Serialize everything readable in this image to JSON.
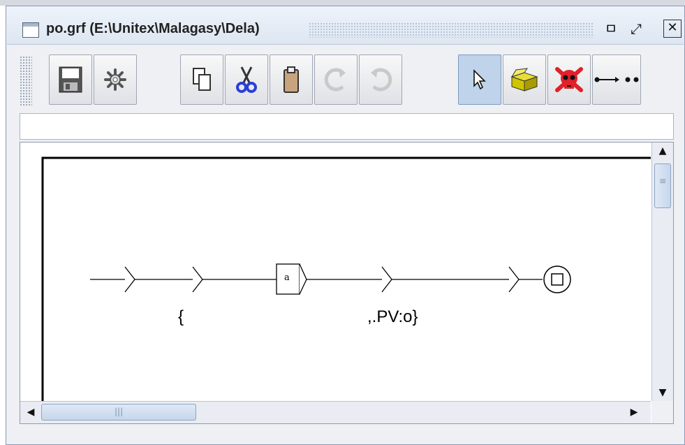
{
  "window": {
    "title": "po.grf (E:\\Unitex\\Malagasy\\Dela)",
    "icons": {
      "app": "window-icon",
      "minimize": "minimize-icon",
      "maximize": "maximize-icon",
      "close": "close-icon"
    },
    "minimize_glyph": "ㅁ",
    "maximize_glyph": "⤢",
    "close_glyph": "✕"
  },
  "toolbar": {
    "buttons": [
      {
        "id": "save",
        "icon": "save-icon"
      },
      {
        "id": "compile",
        "icon": "gear-icon"
      },
      {
        "id": "copy",
        "icon": "copy-icon"
      },
      {
        "id": "cut",
        "icon": "scissors-icon"
      },
      {
        "id": "paste",
        "icon": "paste-icon"
      },
      {
        "id": "redo",
        "icon": "redo-icon"
      },
      {
        "id": "undo",
        "icon": "undo-icon"
      },
      {
        "id": "select",
        "icon": "pointer-icon",
        "active": true
      },
      {
        "id": "open-box",
        "icon": "box-icon"
      },
      {
        "id": "kill",
        "icon": "skull-icon"
      },
      {
        "id": "link",
        "icon": "link-icon"
      }
    ]
  },
  "box_text_field": {
    "value": ""
  },
  "graph": {
    "boxes": [
      {
        "id": "box-a",
        "label": "a"
      }
    ],
    "outputs": [
      {
        "id": "output-1",
        "text": "{"
      },
      {
        "id": "output-2",
        "text": ",.PV:o}"
      }
    ]
  },
  "scroll": {
    "up": "▲",
    "down": "▼",
    "left": "◀",
    "right": "▶"
  },
  "colors": {
    "active_button": "#bfd3ea",
    "skull": "#e0202a",
    "box_icon": "#cfc400",
    "scissors": "#2a3ed8"
  }
}
